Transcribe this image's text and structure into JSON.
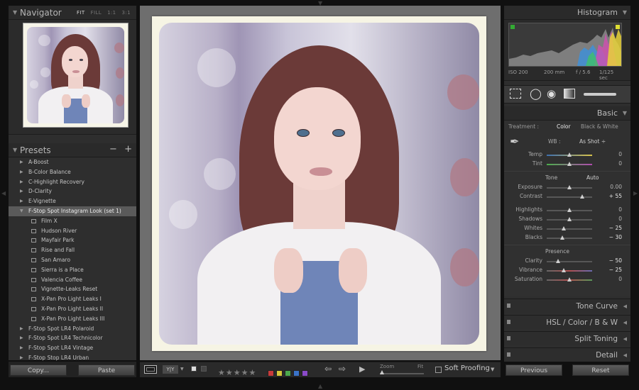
{
  "navigator": {
    "title": "Navigator",
    "options": [
      "FIT",
      "FILL",
      "1:1",
      "3:1"
    ],
    "active_option": "FIT"
  },
  "presets": {
    "title": "Presets",
    "minus": "−",
    "plus": "+",
    "items": [
      {
        "label": "A-Boost",
        "type": "folder"
      },
      {
        "label": "B-Color Balance",
        "type": "folder"
      },
      {
        "label": "C-Highlight Recovery",
        "type": "folder"
      },
      {
        "label": "D-Clarity",
        "type": "folder"
      },
      {
        "label": "E-Vignette",
        "type": "folder"
      },
      {
        "label": "F-Stop Spot Instagram Look (set 1)",
        "type": "open-folder"
      },
      {
        "label": "Film X",
        "type": "item"
      },
      {
        "label": "Hudson River",
        "type": "item"
      },
      {
        "label": "Mayfair Park",
        "type": "item"
      },
      {
        "label": "Rise and Fall",
        "type": "item"
      },
      {
        "label": "San Amaro",
        "type": "item"
      },
      {
        "label": "Sierra is a Place",
        "type": "item"
      },
      {
        "label": "Valencia Coffee",
        "type": "item"
      },
      {
        "label": "Vignette-Leaks Reset",
        "type": "item"
      },
      {
        "label": "X-Pan Pro Light Leaks I",
        "type": "item"
      },
      {
        "label": "X-Pan Pro Light Leaks II",
        "type": "item"
      },
      {
        "label": "X-Pan Pro Light Leaks III",
        "type": "item"
      },
      {
        "label": "F-Stop Spot LR4 Polaroid",
        "type": "folder"
      },
      {
        "label": "F-Stop Spot LR4 Technicolor",
        "type": "folder"
      },
      {
        "label": "F-Stop Spot LR4 Vintage",
        "type": "folder"
      },
      {
        "label": "F-Stop Stop LR4 Urban",
        "type": "folder"
      }
    ]
  },
  "left_buttons": {
    "copy": "Copy...",
    "paste": "Paste"
  },
  "toolbar": {
    "view_mode": "Y|Y",
    "stars": [
      "★",
      "★",
      "★",
      "★",
      "★"
    ],
    "color_labels": [
      "#c83a3a",
      "#d6c73a",
      "#4ca84c",
      "#3a73c8",
      "#8a4ac8"
    ],
    "zoom_label": "Zoom",
    "fit_label": "Fit",
    "soft_proofing": "Soft Proofing"
  },
  "histogram": {
    "title": "Histogram",
    "iso": "ISO 200",
    "focal": "200 mm",
    "aperture": "f / 5.6",
    "shutter": "1/125 sec"
  },
  "basic": {
    "title": "Basic",
    "treatment_label": "Treatment :",
    "treatment_color": "Color",
    "treatment_bw": "Black & White",
    "wb_label": "WB :",
    "wb_value": "As Shot ÷",
    "wb_sliders": [
      {
        "label": "Temp",
        "value": "0",
        "level": 0.5
      },
      {
        "label": "Tint",
        "value": "0",
        "level": 0.5
      }
    ],
    "tone_label": "Tone",
    "auto_label": "Auto",
    "tone_sliders_1": [
      {
        "label": "Exposure",
        "value": "0.00",
        "level": 0.5,
        "bright": false
      },
      {
        "label": "Contrast",
        "value": "+ 55",
        "level": 0.78,
        "bright": true
      }
    ],
    "tone_sliders_2": [
      {
        "label": "Highlights",
        "value": "0",
        "level": 0.5,
        "bright": false
      },
      {
        "label": "Shadows",
        "value": "0",
        "level": 0.5,
        "bright": false
      },
      {
        "label": "Whites",
        "value": "− 25",
        "level": 0.38,
        "bright": true
      },
      {
        "label": "Blacks",
        "value": "− 30",
        "level": 0.35,
        "bright": true
      }
    ],
    "presence_label": "Presence",
    "presence_sliders": [
      {
        "label": "Clarity",
        "value": "− 50",
        "level": 0.25,
        "bright": true
      },
      {
        "label": "Vibrance",
        "value": "− 25",
        "level": 0.38,
        "bright": true
      },
      {
        "label": "Saturation",
        "value": "0",
        "level": 0.5,
        "bright": false
      }
    ]
  },
  "panels": {
    "tone_curve": "Tone Curve",
    "hsl": "HSL   /   Color   /   B & W",
    "split_toning": "Split Toning",
    "detail": "Detail"
  },
  "right_buttons": {
    "previous": "Previous",
    "reset": "Reset"
  }
}
